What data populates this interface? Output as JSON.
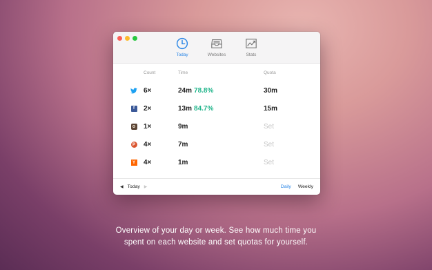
{
  "window": {
    "tabs": [
      {
        "label": "Today",
        "icon": "clock-icon",
        "active": true
      },
      {
        "label": "Websites",
        "icon": "inbox-icon",
        "active": false
      },
      {
        "label": "Stats",
        "icon": "chart-icon",
        "active": false
      }
    ]
  },
  "table": {
    "headers": {
      "count": "Count",
      "time": "Time",
      "quota": "Quota"
    },
    "rows": [
      {
        "site": "twitter",
        "icon": "twitter-icon",
        "count": "6×",
        "time": "24m",
        "percent": "78.8%",
        "quota": "30m"
      },
      {
        "site": "facebook",
        "icon": "facebook-icon",
        "count": "2×",
        "time": "13m",
        "percent": "84.7%",
        "quota": "15m"
      },
      {
        "site": "instagram",
        "icon": "instagram-icon",
        "count": "1×",
        "time": "9m",
        "percent": "",
        "quota": "Set"
      },
      {
        "site": "producthunt",
        "icon": "producthunt-icon",
        "count": "4×",
        "time": "7m",
        "percent": "",
        "quota": "Set"
      },
      {
        "site": "hackernews",
        "icon": "hackernews-icon",
        "count": "4×",
        "time": "1m",
        "percent": "",
        "quota": "Set"
      }
    ]
  },
  "footer": {
    "period_label": "Today",
    "modes": {
      "daily": "Daily",
      "weekly": "Weekly"
    }
  },
  "caption": {
    "line1": "Overview of your day or week. See how much time you",
    "line2": "spent on each website and set quotas for yourself."
  },
  "colors": {
    "accent": "#2a86e6",
    "percent": "#1fb48a",
    "twitter": "#1da1f2",
    "facebook": "#3b5998",
    "instagram": "#5a4435",
    "producthunt": "#da552f",
    "hackernews": "#ff6600"
  }
}
